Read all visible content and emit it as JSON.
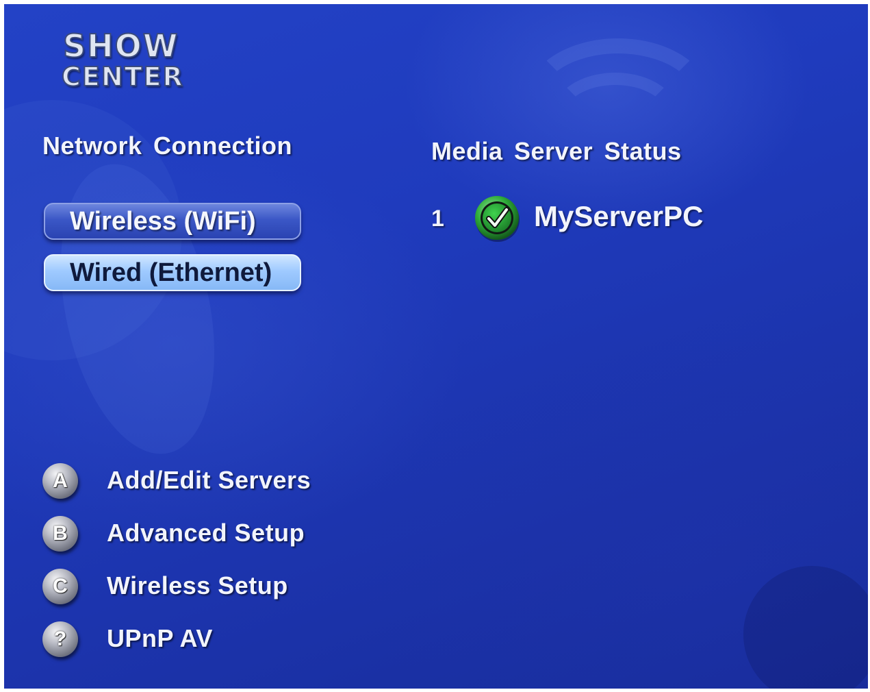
{
  "app": {
    "logo_line1": "SHOW",
    "logo_line2": "CENTER"
  },
  "network_connection": {
    "heading": "Network Connection",
    "options": [
      {
        "label": "Wireless (WiFi)",
        "selected": false
      },
      {
        "label": "Wired (Ethernet)",
        "selected": true
      }
    ]
  },
  "media_server_status": {
    "heading": "Media Server Status",
    "servers": [
      {
        "index": "1",
        "name": "MyServerPC",
        "status_icon": "green-check-icon"
      }
    ]
  },
  "menu": {
    "items": [
      {
        "key": "A",
        "label": "Add/Edit Servers"
      },
      {
        "key": "B",
        "label": "Advanced Setup"
      },
      {
        "key": "C",
        "label": "Wireless Setup"
      },
      {
        "key": "?",
        "label": "UPnP AV"
      }
    ]
  },
  "colors": {
    "background": "#1f3bbd",
    "selected_button": "#9fcaff",
    "unselected_button": "#3b57c6",
    "status_ok": "#2fae3a",
    "text": "#f2f4fb"
  }
}
